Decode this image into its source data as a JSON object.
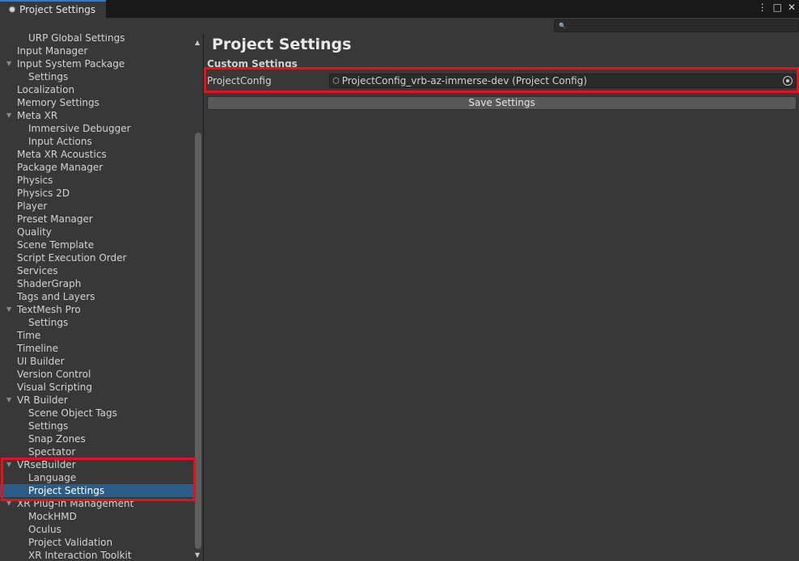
{
  "window": {
    "tab_title": "Project Settings",
    "more_icon": "⋮",
    "maximize_icon": "□",
    "close_icon": "✕"
  },
  "search": {
    "placeholder": "",
    "icon": "🔍"
  },
  "sidebar": {
    "items": [
      {
        "label": "URP Global Settings",
        "level": 1
      },
      {
        "label": "Input Manager",
        "level": 0
      },
      {
        "label": "Input System Package",
        "level": 0,
        "expanded": true
      },
      {
        "label": "Settings",
        "level": 1
      },
      {
        "label": "Localization",
        "level": 0
      },
      {
        "label": "Memory Settings",
        "level": 0
      },
      {
        "label": "Meta XR",
        "level": 0,
        "expanded": true
      },
      {
        "label": "Immersive Debugger",
        "level": 1
      },
      {
        "label": "Input Actions",
        "level": 1
      },
      {
        "label": "Meta XR Acoustics",
        "level": 0
      },
      {
        "label": "Package Manager",
        "level": 0
      },
      {
        "label": "Physics",
        "level": 0
      },
      {
        "label": "Physics 2D",
        "level": 0
      },
      {
        "label": "Player",
        "level": 0
      },
      {
        "label": "Preset Manager",
        "level": 0
      },
      {
        "label": "Quality",
        "level": 0
      },
      {
        "label": "Scene Template",
        "level": 0
      },
      {
        "label": "Script Execution Order",
        "level": 0
      },
      {
        "label": "Services",
        "level": 0
      },
      {
        "label": "ShaderGraph",
        "level": 0
      },
      {
        "label": "Tags and Layers",
        "level": 0
      },
      {
        "label": "TextMesh Pro",
        "level": 0,
        "expanded": true
      },
      {
        "label": "Settings",
        "level": 1
      },
      {
        "label": "Time",
        "level": 0
      },
      {
        "label": "Timeline",
        "level": 0
      },
      {
        "label": "UI Builder",
        "level": 0
      },
      {
        "label": "Version Control",
        "level": 0
      },
      {
        "label": "Visual Scripting",
        "level": 0
      },
      {
        "label": "VR Builder",
        "level": 0,
        "expanded": true
      },
      {
        "label": "Scene Object Tags",
        "level": 1
      },
      {
        "label": "Settings",
        "level": 1
      },
      {
        "label": "Snap Zones",
        "level": 1
      },
      {
        "label": "Spectator",
        "level": 1
      },
      {
        "label": "VRseBuilder",
        "level": 0,
        "expanded": true
      },
      {
        "label": "Language",
        "level": 1
      },
      {
        "label": "Project Settings",
        "level": 1,
        "selected": true
      },
      {
        "label": "XR Plug-in Management",
        "level": 0,
        "expanded": true
      },
      {
        "label": "MockHMD",
        "level": 1
      },
      {
        "label": "Oculus",
        "level": 1
      },
      {
        "label": "Project Validation",
        "level": 1
      },
      {
        "label": "XR Interaction Toolkit",
        "level": 1
      }
    ]
  },
  "main": {
    "title": "Project Settings",
    "section_header": "Custom Settings",
    "field_label": "ProjectConfig",
    "field_value": "ProjectConfig_vrb-az-immerse-dev (Project Config)",
    "save_button": "Save Settings"
  },
  "colors": {
    "background": "#383838",
    "selection": "#2c5d87",
    "highlight": "#e0141e"
  }
}
